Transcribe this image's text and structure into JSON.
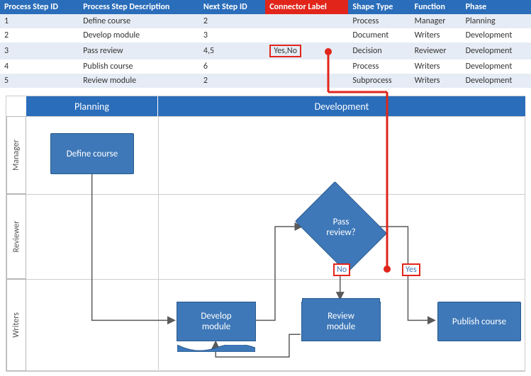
{
  "table": {
    "headers": {
      "id": "Process Step ID",
      "desc": "Process Step Description",
      "next": "Next Step ID",
      "conn": "Connector Label",
      "shape": "Shape Type",
      "func": "Function",
      "phase": "Phase"
    },
    "rows": [
      {
        "id": "1",
        "desc": "Define course",
        "next": "2",
        "conn": "",
        "shape": "Process",
        "func": "Manager",
        "phase": "Planning"
      },
      {
        "id": "2",
        "desc": "Develop module",
        "next": "3",
        "conn": "",
        "shape": "Document",
        "func": "Writers",
        "phase": "Development"
      },
      {
        "id": "3",
        "desc": "Pass review",
        "next": "4,5",
        "conn": "Yes,No",
        "shape": "Decision",
        "func": "Reviewer",
        "phase": "Development"
      },
      {
        "id": "4",
        "desc": "Publish course",
        "next": "6",
        "conn": "",
        "shape": "Process",
        "func": "Writers",
        "phase": "Development"
      },
      {
        "id": "5",
        "desc": "Review module",
        "next": "2",
        "conn": "",
        "shape": "Subprocess",
        "func": "Writers",
        "phase": "Development"
      }
    ]
  },
  "diagram": {
    "phases": {
      "p1": "Planning",
      "p2": "Development"
    },
    "lanes": {
      "l1": "Manager",
      "l2": "Reviewer",
      "l3": "Writers"
    },
    "shapes": {
      "define": "Define course",
      "develop": "Develop\nmodule",
      "review": "Review\nmodule",
      "publish": "Publish course",
      "decision": "Pass\nreview?"
    },
    "conditions": {
      "no": "No",
      "yes": "Yes"
    }
  },
  "chart_data": {
    "type": "table",
    "title": "Process flowchart data mapping",
    "columns": [
      "Process Step ID",
      "Process Step Description",
      "Next Step ID",
      "Connector Label",
      "Shape Type",
      "Function",
      "Phase"
    ],
    "rows": [
      [
        1,
        "Define course",
        "2",
        "",
        "Process",
        "Manager",
        "Planning"
      ],
      [
        2,
        "Develop module",
        "3",
        "",
        "Document",
        "Writers",
        "Development"
      ],
      [
        3,
        "Pass review",
        "4,5",
        "Yes,No",
        "Decision",
        "Reviewer",
        "Development"
      ],
      [
        4,
        "Publish course",
        "6",
        "",
        "Process",
        "Writers",
        "Development"
      ],
      [
        5,
        "Review module",
        "2",
        "",
        "Subprocess",
        "Writers",
        "Development"
      ]
    ],
    "flow": {
      "nodes": [
        {
          "id": 1,
          "label": "Define course",
          "type": "process",
          "lane": "Manager",
          "phase": "Planning"
        },
        {
          "id": 2,
          "label": "Develop module",
          "type": "document",
          "lane": "Writers",
          "phase": "Development"
        },
        {
          "id": 3,
          "label": "Pass review?",
          "type": "decision",
          "lane": "Reviewer",
          "phase": "Development"
        },
        {
          "id": 4,
          "label": "Publish course",
          "type": "process",
          "lane": "Writers",
          "phase": "Development"
        },
        {
          "id": 5,
          "label": "Review module",
          "type": "subprocess",
          "lane": "Writers",
          "phase": "Development"
        }
      ],
      "edges": [
        {
          "from": 1,
          "to": 2,
          "label": ""
        },
        {
          "from": 2,
          "to": 3,
          "label": ""
        },
        {
          "from": 3,
          "to": 5,
          "label": "No"
        },
        {
          "from": 3,
          "to": 4,
          "label": "Yes"
        },
        {
          "from": 5,
          "to": 2,
          "label": ""
        }
      ]
    }
  }
}
